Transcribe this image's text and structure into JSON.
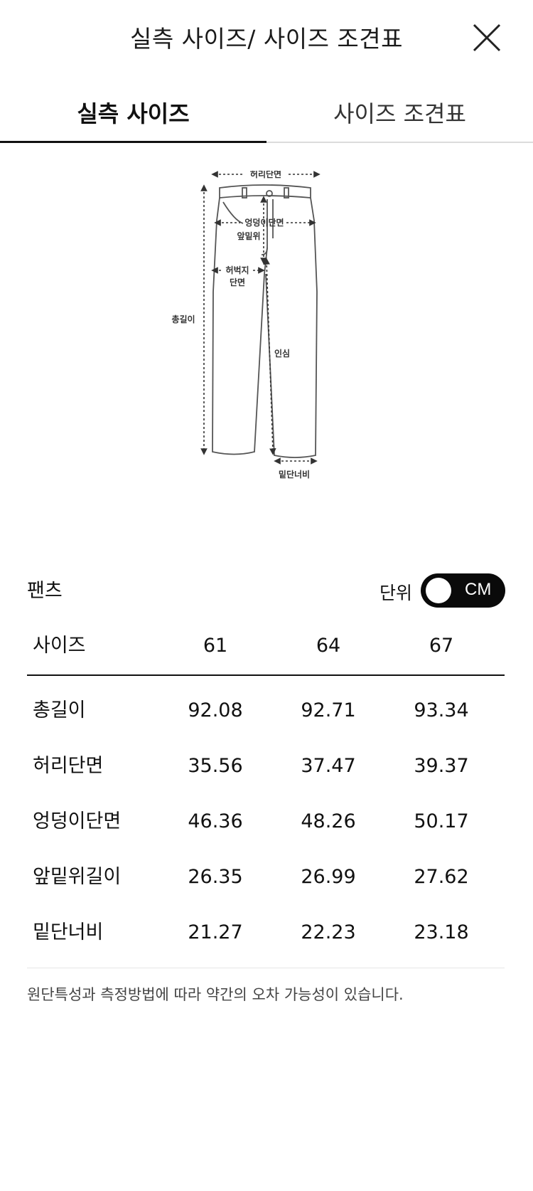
{
  "header": {
    "title": "실측 사이즈/ 사이즈 조견표",
    "close_icon": "close-icon"
  },
  "tabs": [
    {
      "label": "실측 사이즈",
      "active": true
    },
    {
      "label": "사이즈 조견표",
      "active": false
    }
  ],
  "diagram": {
    "labels": {
      "waist": "허리단면",
      "hip": "엉덩이단면",
      "front_rise": "앞밑위",
      "thigh_line1": "허벅지",
      "thigh_line2": "단면",
      "total_length": "총길이",
      "inseam": "인심",
      "hem": "밑단너비"
    }
  },
  "section": {
    "title": "팬츠",
    "unit_label": "단위",
    "unit_value": "CM"
  },
  "table": {
    "header_label": "사이즈",
    "sizes": [
      "61",
      "64",
      "67"
    ],
    "rows": [
      {
        "label": "총길이",
        "values": [
          "92.08",
          "92.71",
          "93.34"
        ]
      },
      {
        "label": "허리단면",
        "values": [
          "35.56",
          "37.47",
          "39.37"
        ]
      },
      {
        "label": "엉덩이단면",
        "values": [
          "46.36",
          "48.26",
          "50.17"
        ]
      },
      {
        "label": "앞밑위길이",
        "values": [
          "26.35",
          "26.99",
          "27.62"
        ]
      },
      {
        "label": "밑단너비",
        "values": [
          "21.27",
          "22.23",
          "23.18"
        ]
      }
    ]
  },
  "note": "원단특성과 측정방법에 따라 약간의 오차 가능성이 있습니다."
}
